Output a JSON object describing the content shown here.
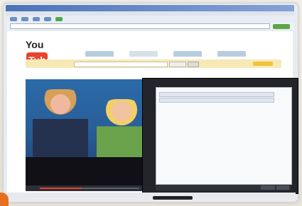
{
  "browser": {
    "address_value": "",
    "menu_items": [
      "",
      "",
      "",
      "",
      "",
      "",
      ""
    ]
  },
  "site": {
    "logo_text": "You",
    "logo_tube_text": "Tube",
    "top_links": "",
    "video_title": "",
    "search_value": "",
    "player_progress": 0.42
  },
  "dialog": {
    "title": "",
    "status": ""
  }
}
